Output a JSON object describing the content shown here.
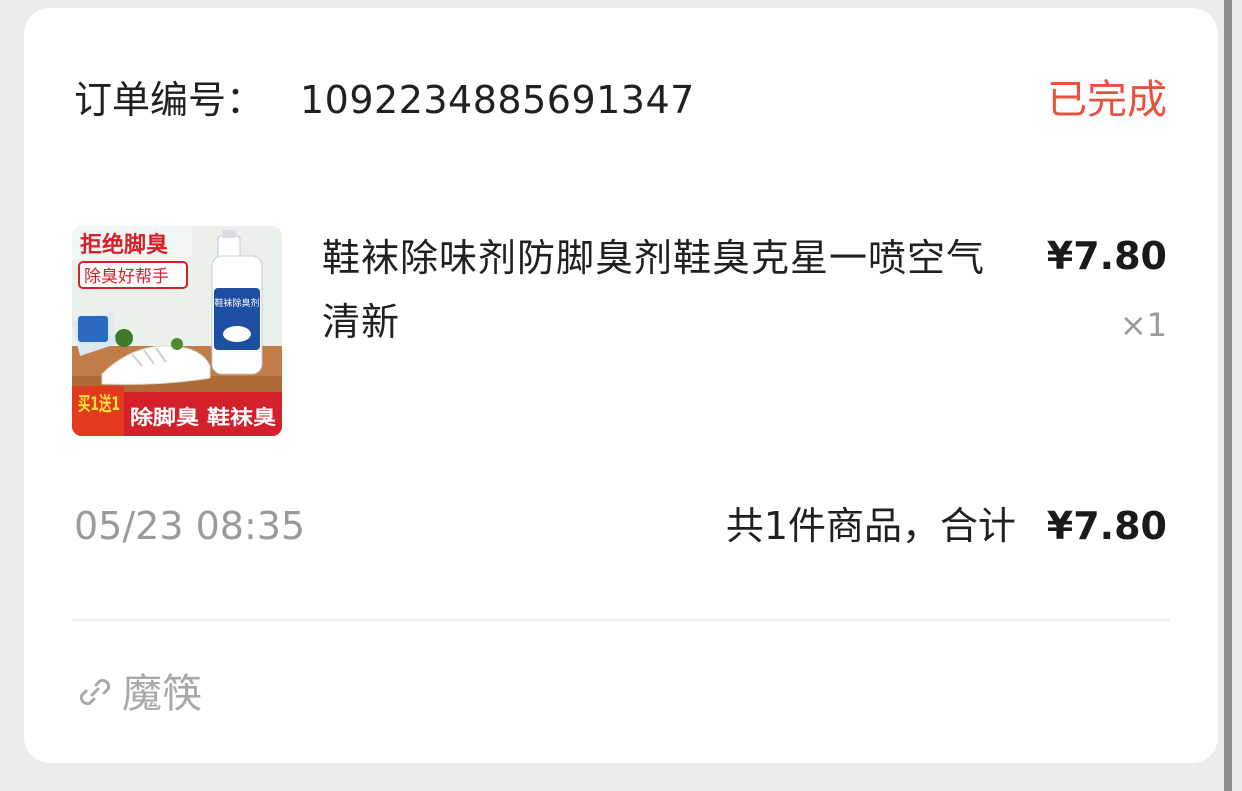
{
  "order": {
    "number_label": "订单编号：",
    "number": "1092234885691347",
    "status": "已完成",
    "status_color": "#e8533f"
  },
  "item": {
    "title": "鞋袜除味剂防脚臭剂鞋臭克星一喷空气清新",
    "price": "¥7.80",
    "quantity": "×1",
    "image_text": {
      "top_title": "拒绝脚臭",
      "top_tag": "除臭好帮手",
      "bottle_label": "鞋袜除臭剂",
      "promo": "买1送1",
      "bottom_banner": "除脚臭 鞋袜臭"
    }
  },
  "footer": {
    "date": "05/23 08:35",
    "summary": "共1件商品，合计",
    "total": "¥7.80"
  },
  "shop": {
    "icon": "link-icon",
    "name": "魔筷"
  }
}
